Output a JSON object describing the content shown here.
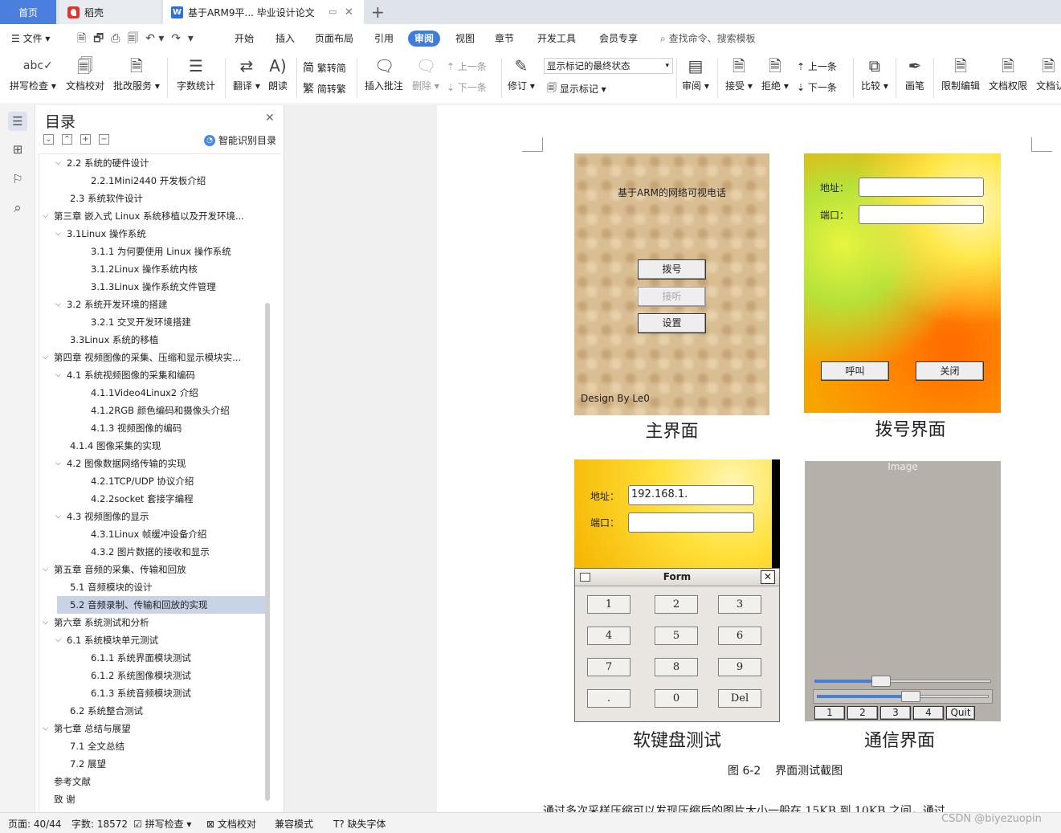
{
  "tabs": {
    "home": "首页",
    "daoke": "稻壳",
    "doc": "基于ARM9平... 毕业设计论文"
  },
  "menu": {
    "file": "文件",
    "items": [
      "开始",
      "插入",
      "页面布局",
      "引用",
      "审阅",
      "视图",
      "章节",
      "开发工具",
      "会员专享"
    ],
    "search": "查找命令、搜索模板"
  },
  "ribbon": {
    "spell": "拼写检查",
    "proof": "文档校对",
    "batch": "批改服务",
    "wordcount": "字数统计",
    "translate": "翻译",
    "read": "朗读",
    "trad": "繁转简",
    "simp": "简转繁",
    "insert_comment": "插入批注",
    "delete": "删除",
    "prev": "上一条",
    "next": "下一条",
    "revise": "修订",
    "markup_state": "显示标记的最终状态",
    "show_markup": "显示标记",
    "review": "审阅",
    "accept": "接受",
    "reject": "拒绝",
    "prev2": "上一条",
    "next2": "下一条",
    "compare": "比较",
    "pen": "画笔",
    "restrict": "限制编辑",
    "perm": "文档权限",
    "more": "文档认"
  },
  "toc": {
    "title": "目录",
    "smart": "智能识别目录",
    "items": [
      {
        "label": "2.2 系统的硬件设计",
        "level": 1,
        "arrow": true
      },
      {
        "label": "2.2.1Mini2440 开发板介绍",
        "level": 2
      },
      {
        "label": "2.3  系统软件设计",
        "level": 1
      },
      {
        "label": "第三章  嵌入式 Linux 系统移植以及开发环境...",
        "level": 0,
        "arrow": true
      },
      {
        "label": "3.1Linux 操作系统",
        "level": 1,
        "arrow": true
      },
      {
        "label": "3.1.1 为何要使用 Linux 操作系统",
        "level": 2
      },
      {
        "label": "3.1.2Linux 操作系统内核",
        "level": 2
      },
      {
        "label": "3.1.3Linux 操作系统文件管理",
        "level": 2
      },
      {
        "label": "3.2  系统开发环境的搭建",
        "level": 1,
        "arrow": true
      },
      {
        "label": "3.2.1 交叉开发环境搭建",
        "level": 2
      },
      {
        "label": "3.3Linux 系统的移植",
        "level": 1
      },
      {
        "label": "第四章  视频图像的采集、压缩和显示模块实...",
        "level": 0,
        "arrow": true
      },
      {
        "label": "4.1 系统视频图像的采集和编码",
        "level": 1,
        "arrow": true
      },
      {
        "label": "4.1.1Video4Linux2 介绍",
        "level": 2
      },
      {
        "label": "4.1.2RGB 颜色编码和摄像头介绍",
        "level": 2
      },
      {
        "label": "4.1.3 视频图像的编码",
        "level": 2
      },
      {
        "label": "4.1.4 图像采集的实现",
        "level": 1
      },
      {
        "label": "4.2 图像数据网络传输的实现",
        "level": 1,
        "arrow": true
      },
      {
        "label": "4.2.1TCP/UDP 协议介绍",
        "level": 2
      },
      {
        "label": "4.2.2socket 套接字编程",
        "level": 2
      },
      {
        "label": "4.3 视频图像的显示",
        "level": 1,
        "arrow": true
      },
      {
        "label": "4.3.1Linux 帧缓冲设备介绍",
        "level": 2
      },
      {
        "label": "4.3.2 图片数据的接收和显示",
        "level": 2
      },
      {
        "label": "第五章  音频的采集、传输和回放",
        "level": 0,
        "arrow": true
      },
      {
        "label": "5.1 音频模块的设计",
        "level": 1
      },
      {
        "label": "5.2 音频录制、传输和回放的实现",
        "level": 1,
        "selected": true
      },
      {
        "label": "第六章  系统测试和分析",
        "level": 0,
        "arrow": true
      },
      {
        "label": "6.1 系统模块单元测试",
        "level": 1,
        "arrow": true
      },
      {
        "label": "6.1.1 系统界面模块测试",
        "level": 2
      },
      {
        "label": "6.1.2 系统图像模块测试",
        "level": 2
      },
      {
        "label": "6.1.3 系统音频模块测试",
        "level": 2
      },
      {
        "label": "6.2 系统整合测试",
        "level": 1
      },
      {
        "label": "第七章  总结与展望",
        "level": 0,
        "arrow": true
      },
      {
        "label": "7.1 全文总结",
        "level": 1
      },
      {
        "label": "7.2 展望",
        "level": 1
      },
      {
        "label": "参考文献",
        "level": 0
      },
      {
        "label": "致    谢",
        "level": 0
      }
    ]
  },
  "figure": {
    "main": {
      "title": "基于ARM的网络可视电话",
      "dial": "拨号",
      "listen": "接听",
      "settings": "设置",
      "credit": "Design By Le0",
      "caption": "主界面"
    },
    "dial": {
      "addr_label": "地址：",
      "port_label": "端口：",
      "call": "呼叫",
      "close": "关闭",
      "caption": "拨号界面"
    },
    "keyboard": {
      "addr_label": "地址：",
      "port_label": "端口：",
      "addr_value": "192.168.1.",
      "form_title": "Form",
      "keys": [
        "1",
        "2",
        "3",
        "4",
        "5",
        "6",
        "7",
        "8",
        "9",
        ".",
        "0",
        "Del"
      ],
      "caption": "软键盘测试"
    },
    "comm": {
      "image_label": "Image",
      "buttons": [
        "1",
        "2",
        "3",
        "4",
        "Quit"
      ],
      "caption": "通信界面"
    },
    "figure_caption": "图 6-2    界面测试截图",
    "body_text": "通过多次采样压缩可以发现压缩后的图片大小一般在 15KB 到 10KB 之间，通过"
  },
  "status": {
    "page": "页面: 40/44",
    "words": "字数: 18572",
    "spell": "拼写检查",
    "proof": "文档校对",
    "compat": "兼容模式",
    "missing_font": "缺失字体"
  },
  "watermark": "CSDN @biyezuopin"
}
